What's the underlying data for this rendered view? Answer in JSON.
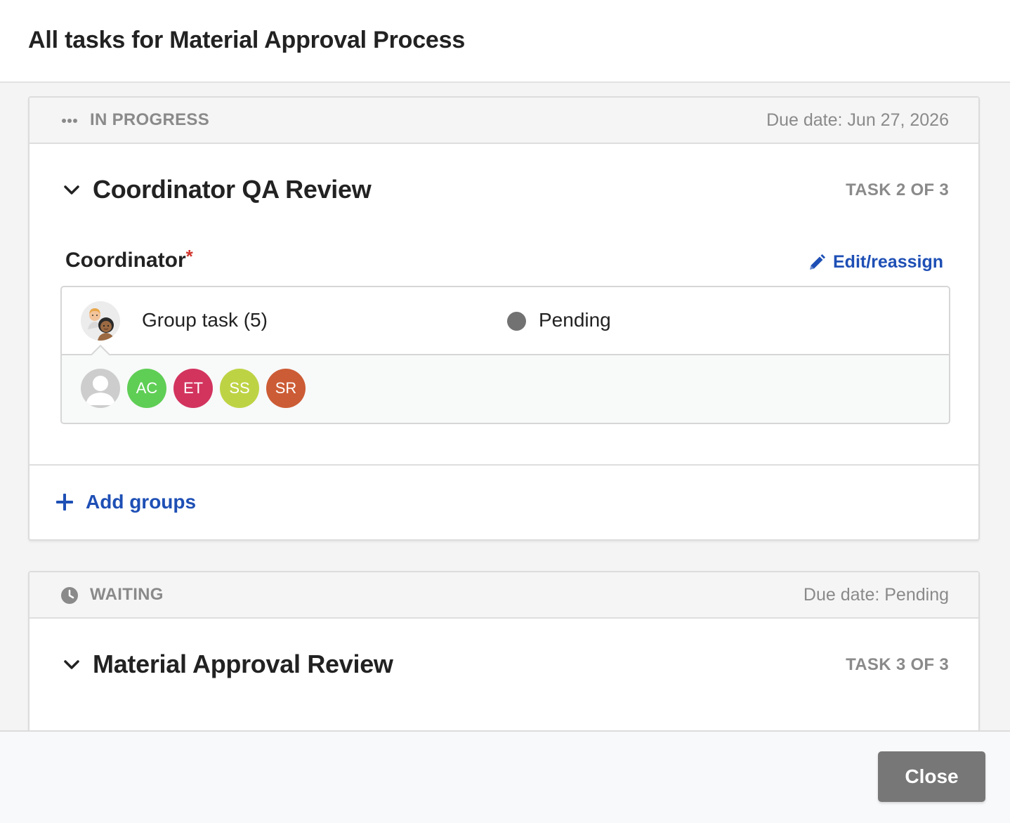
{
  "modal": {
    "title": "All tasks for Material Approval Process"
  },
  "tasks": [
    {
      "status": "IN PROGRESS",
      "status_icon": "more-dots-icon",
      "due_date": "Due date: Jun 27, 2026",
      "title": "Coordinator QA Review",
      "counter": "TASK 2 OF 3",
      "role": "Coordinator",
      "required": "*",
      "edit_label": "Edit/reassign",
      "assignee": {
        "name": "Group task (5)",
        "status": "Pending"
      },
      "members": [
        {
          "initials": "",
          "color": "#c9c9c9",
          "kind": "placeholder"
        },
        {
          "initials": "AC",
          "color": "#5fce55"
        },
        {
          "initials": "ET",
          "color": "#d2345e"
        },
        {
          "initials": "SS",
          "color": "#bed344"
        },
        {
          "initials": "SR",
          "color": "#cc5c35"
        }
      ],
      "add_label": "Add groups"
    },
    {
      "status": "WAITING",
      "status_icon": "clock-icon",
      "due_date": "Due date: Pending",
      "title": "Material Approval Review",
      "counter": "TASK 3 OF 3"
    }
  ],
  "footer": {
    "close_label": "Close"
  },
  "colors": {
    "link": "#1e4fb5",
    "status_gray": "#8a8a8a",
    "pending_dot": "#727272",
    "close_button": "#777777"
  }
}
